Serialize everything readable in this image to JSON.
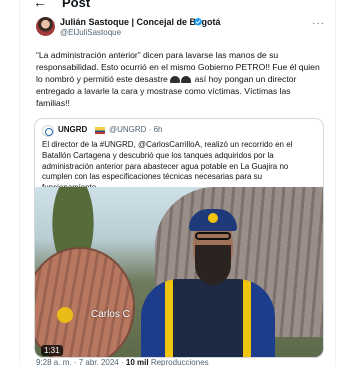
{
  "header": {
    "back_glyph": "←",
    "title": "Post"
  },
  "tweet": {
    "author_name": "Julián Sastoque | Concejal de Bogotá",
    "handle": "@ElJuliSastoque",
    "text_before_emoji": "“La administración anterior” dicen para lavarse las manos de su responsabilidad. Esto ocurrió en el mismo Gobierno PETRO!! Fue él quien lo nombró y permitió este desastre",
    "text_after_emoji": " así hoy pongan un director entregado a lavarle la cara y mostrase como víctimas. Víctimas las familias!!",
    "more_glyph": "···"
  },
  "quote": {
    "name": "UNGRD",
    "handle": "@UNGRD",
    "time": "6h",
    "separator": "·",
    "text": "El director de la #UNGRD, @CarlosCarrilloA, realizó un recorrido en el Batallón Cartagena y descubrió que los tanques adquiridos por la administración anterior para abastecer agua potable en La Guajira no cumplen con las especificaciones técnicas necesarias para su funcionamiento",
    "video": {
      "overlay_name": "Carlos C",
      "duration": "1:31"
    }
  },
  "meta": {
    "time": "9:28 a. m.",
    "date": "7 abr. 2024",
    "views": "10 mil",
    "views_label": "Reproducciones",
    "separator": "·"
  },
  "colors": {
    "text": "#0f1419",
    "secondary": "#536471",
    "verified": "#1d9bf0",
    "border": "#cfd9de"
  },
  "icons": [
    "back-arrow-icon",
    "verified-icon",
    "more-icon",
    "cap-emoji-icon",
    "flag-icon"
  ]
}
